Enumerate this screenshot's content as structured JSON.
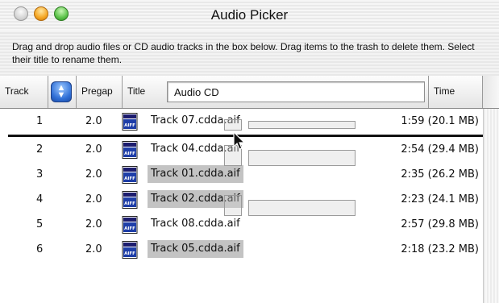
{
  "window": {
    "title": "Audio Picker"
  },
  "instructions": "Drag and drop audio files or CD audio tracks in the box below. Drag items to the trash to delete them. Select their title to rename them.",
  "columns": {
    "track": "Track",
    "sort_icon": "up-down-arrows-icon",
    "pregap": "Pregap",
    "title": "Title",
    "title_value": "Audio CD",
    "time": "Time"
  },
  "tracks": [
    {
      "num": "1",
      "pregap": "2.0",
      "title": "Track 07.cdda.aif",
      "time": "1:59 (20.1 MB)",
      "selected": false
    },
    {
      "num": "2",
      "pregap": "2.0",
      "title": "Track 04.cdda.aif",
      "time": "2:54 (29.4 MB)",
      "selected": false
    },
    {
      "num": "3",
      "pregap": "2.0",
      "title": "Track 01.cdda.aif",
      "time": "2:35 (26.2 MB)",
      "selected": true
    },
    {
      "num": "4",
      "pregap": "2.0",
      "title": "Track 02.cdda.aif",
      "time": "2:23 (24.1 MB)",
      "selected": true
    },
    {
      "num": "5",
      "pregap": "2.0",
      "title": "Track 08.cdda.aif",
      "time": "2:57 (29.8 MB)",
      "selected": false
    },
    {
      "num": "6",
      "pregap": "2.0",
      "title": "Track 05.cdda.aif",
      "time": "2:18 (23.2 MB)",
      "selected": true
    }
  ],
  "file_icon_label": "AIFF",
  "colors": {
    "selection": "#c3c3c3",
    "sort_button": "#2f6fd6",
    "close": "#d4d4d4",
    "minimize": "#f5a623",
    "zoom": "#5cc34a"
  }
}
